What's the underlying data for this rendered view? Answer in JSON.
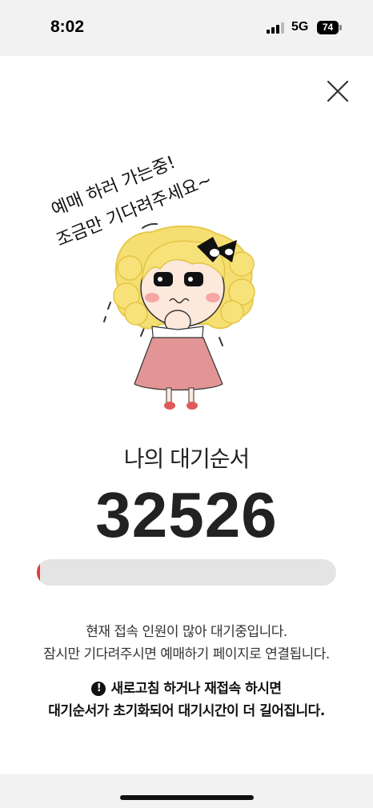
{
  "status_bar": {
    "time": "8:02",
    "network": "5G",
    "battery": "74"
  },
  "illustration": {
    "speech_line1": "예매 하러 가는중!",
    "speech_line2": "조금만 기다려주세요~"
  },
  "queue": {
    "title": "나의 대기순서",
    "number": "32526",
    "progress": 0.01
  },
  "info": {
    "line1": "현재 접속 인원이 많아 대기중입니다.",
    "line2": "잠시만 기다려주시면 예매하기 페이지로 연결됩니다."
  },
  "warning": {
    "line1": "새로고침 하거나 재접속 하시면",
    "line2": "대기순서가 초기화되어 대기시간이 더 길어집니다."
  },
  "colors": {
    "accent": "#e03b3b"
  },
  "icons": {
    "close": "close-icon",
    "warning": "exclamation-circle-icon"
  }
}
